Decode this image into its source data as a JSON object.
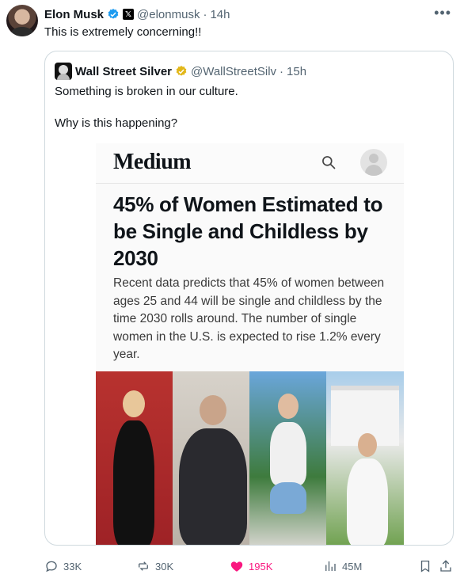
{
  "tweet": {
    "author_name": "Elon Musk",
    "handle": "@elonmusk",
    "separator": "·",
    "time": "14h",
    "text": "This is extremely concerning!!",
    "more_icon": "more-horizontal-icon"
  },
  "quote": {
    "author_name": "Wall Street Silver",
    "handle": "@WallStreetSilv",
    "separator": "·",
    "time": "15h",
    "line1": "Something is broken in our culture.",
    "line2": "Why is this happening?"
  },
  "embed": {
    "logo": "Medium",
    "headline": "45% of Women Estimated to be Single and Childless by 2030",
    "body": "Recent data predicts that 45% of women between ages 25 and 44 will be single and childless by the time 2030 rolls around. The number of single women in the U.S. is expected to rise 1.2% every year."
  },
  "actions": {
    "replies": "33K",
    "reposts": "30K",
    "likes": "195K",
    "views": "45M"
  },
  "colors": {
    "verified_blue": "#1d9bf0",
    "gold": "#e2b719",
    "like_pink": "#f91880",
    "muted": "#536471"
  }
}
